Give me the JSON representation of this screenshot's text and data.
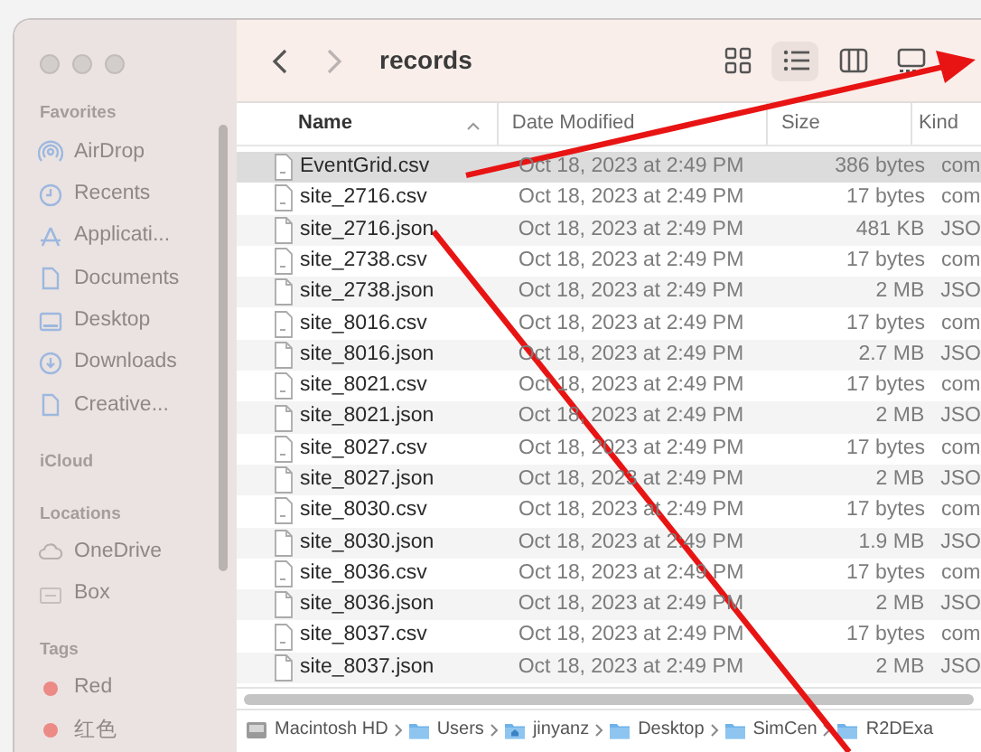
{
  "window": {
    "title": "records"
  },
  "toolbar": {
    "forward_disabled": true,
    "views": [
      {
        "kind": "icons",
        "selected": false
      },
      {
        "kind": "list",
        "selected": true
      },
      {
        "kind": "columns",
        "selected": false
      },
      {
        "kind": "gallery",
        "selected": false
      }
    ]
  },
  "sidebar": {
    "sections": [
      {
        "title": "Favorites",
        "items": [
          {
            "kind": "airdrop",
            "label": "AirDrop"
          },
          {
            "kind": "clock",
            "label": "Recents"
          },
          {
            "kind": "apps",
            "label": "Applicati..."
          },
          {
            "kind": "doc",
            "label": "Documents"
          },
          {
            "kind": "desktop",
            "label": "Desktop"
          },
          {
            "kind": "download",
            "label": "Downloads"
          },
          {
            "kind": "doc",
            "label": "Creative..."
          }
        ]
      },
      {
        "title": "iCloud"
      },
      {
        "title": "Locations",
        "items": [
          {
            "kind": "cloud",
            "label": "OneDrive"
          },
          {
            "kind": "box",
            "label": "Box"
          }
        ]
      },
      {
        "title": "Tags",
        "items": [
          {
            "kind": "tag",
            "label": "Red",
            "color": "#ec8a86"
          },
          {
            "kind": "tag",
            "label": "红色",
            "color": "#ec8a86"
          }
        ]
      }
    ]
  },
  "table": {
    "columns": [
      {
        "label": "Name",
        "sorted": true
      },
      {
        "label": "Date Modified",
        "sorted": false
      },
      {
        "label": "Size",
        "sorted": false
      },
      {
        "label": "Kind",
        "sorted": false
      }
    ],
    "rows": [
      {
        "kind": "csv",
        "selected": true,
        "cells": [
          "EventGrid.csv",
          "Oct 18, 2023 at 2:49 PM",
          "386 bytes",
          "com"
        ]
      },
      {
        "kind": "csv",
        "selected": false,
        "cells": [
          "site_2716.csv",
          "Oct 18, 2023 at 2:49 PM",
          "17 bytes",
          "com"
        ]
      },
      {
        "kind": "json",
        "selected": false,
        "cells": [
          "site_2716.json",
          "Oct 18, 2023 at 2:49 PM",
          "481 KB",
          "JSO"
        ]
      },
      {
        "kind": "csv",
        "selected": false,
        "cells": [
          "site_2738.csv",
          "Oct 18, 2023 at 2:49 PM",
          "17 bytes",
          "com"
        ]
      },
      {
        "kind": "json",
        "selected": false,
        "cells": [
          "site_2738.json",
          "Oct 18, 2023 at 2:49 PM",
          "2 MB",
          "JSO"
        ]
      },
      {
        "kind": "csv",
        "selected": false,
        "cells": [
          "site_8016.csv",
          "Oct 18, 2023 at 2:49 PM",
          "17 bytes",
          "com"
        ]
      },
      {
        "kind": "json",
        "selected": false,
        "cells": [
          "site_8016.json",
          "Oct 18, 2023 at 2:49 PM",
          "2.7 MB",
          "JSO"
        ]
      },
      {
        "kind": "csv",
        "selected": false,
        "cells": [
          "site_8021.csv",
          "Oct 18, 2023 at 2:49 PM",
          "17 bytes",
          "com"
        ]
      },
      {
        "kind": "json",
        "selected": false,
        "cells": [
          "site_8021.json",
          "Oct 18, 2023 at 2:49 PM",
          "2 MB",
          "JSO"
        ]
      },
      {
        "kind": "csv",
        "selected": false,
        "cells": [
          "site_8027.csv",
          "Oct 18, 2023 at 2:49 PM",
          "17 bytes",
          "com"
        ]
      },
      {
        "kind": "json",
        "selected": false,
        "cells": [
          "site_8027.json",
          "Oct 18, 2023 at 2:49 PM",
          "2 MB",
          "JSO"
        ]
      },
      {
        "kind": "csv",
        "selected": false,
        "cells": [
          "site_8030.csv",
          "Oct 18, 2023 at 2:49 PM",
          "17 bytes",
          "com"
        ]
      },
      {
        "kind": "json",
        "selected": false,
        "cells": [
          "site_8030.json",
          "Oct 18, 2023 at 2:49 PM",
          "1.9 MB",
          "JSO"
        ]
      },
      {
        "kind": "csv",
        "selected": false,
        "cells": [
          "site_8036.csv",
          "Oct 18, 2023 at 2:49 PM",
          "17 bytes",
          "com"
        ]
      },
      {
        "kind": "json",
        "selected": false,
        "cells": [
          "site_8036.json",
          "Oct 18, 2023 at 2:49 PM",
          "2 MB",
          "JSO"
        ]
      },
      {
        "kind": "csv",
        "selected": false,
        "cells": [
          "site_8037.csv",
          "Oct 18, 2023 at 2:49 PM",
          "17 bytes",
          "com"
        ]
      },
      {
        "kind": "json",
        "selected": false,
        "cells": [
          "site_8037.json",
          "Oct 18, 2023 at 2:49 PM",
          "2 MB",
          "JSO"
        ]
      }
    ]
  },
  "path_bar": [
    {
      "kind": "disk",
      "label": "Macintosh HD"
    },
    {
      "kind": "folder",
      "label": "Users"
    },
    {
      "kind": "home",
      "label": "jinyanz"
    },
    {
      "kind": "folder",
      "label": "Desktop"
    },
    {
      "kind": "folder",
      "label": "SimCen"
    },
    {
      "kind": "folder",
      "label": "R2DExa"
    }
  ]
}
